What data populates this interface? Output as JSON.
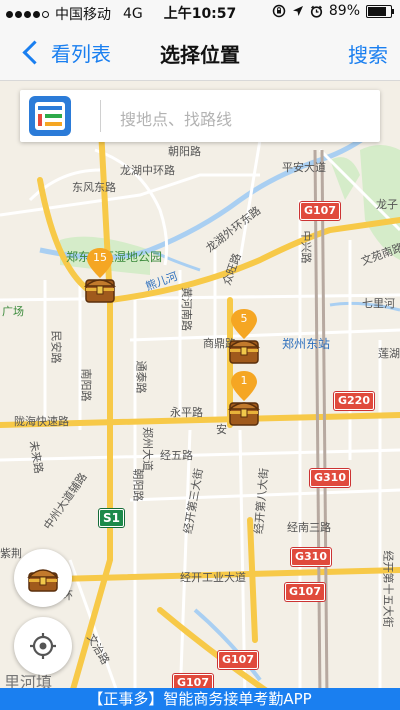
{
  "status_bar": {
    "carrier": "中国移动",
    "network": "4G",
    "time": "上午10:57",
    "battery": "89%",
    "battery_level": 0.89
  },
  "navbar": {
    "back_label": "看列表",
    "title": "选择位置",
    "search_label": "搜索"
  },
  "search": {
    "placeholder": "搜地点、找路线"
  },
  "map": {
    "labels": [
      {
        "text": "朝阳路"
      },
      {
        "text": "龙湖中环路"
      },
      {
        "text": "东风东路"
      },
      {
        "text": "龙湖外环东路"
      },
      {
        "text": "平安大道"
      },
      {
        "text": "龙子"
      },
      {
        "text": "文苑南路"
      },
      {
        "text": "中兴路"
      },
      {
        "text": "众旺路"
      },
      {
        "text": "熊儿河"
      },
      {
        "text": "郑东新区湿地公园"
      },
      {
        "text": "广场"
      },
      {
        "text": "黄河南路"
      },
      {
        "text": "商鼎路"
      },
      {
        "text": "郑州东站"
      },
      {
        "text": "七里河"
      },
      {
        "text": "莲湖"
      },
      {
        "text": "民安路"
      },
      {
        "text": "南阳路"
      },
      {
        "text": "通泰路"
      },
      {
        "text": "永平路"
      },
      {
        "text": "陇海快速路"
      },
      {
        "text": "未来路"
      },
      {
        "text": "郑州大道"
      },
      {
        "text": "经五路"
      },
      {
        "text": "朝阳路"
      },
      {
        "text": "经开第三大街"
      },
      {
        "text": "经开第八大街"
      },
      {
        "text": "经南三路"
      },
      {
        "text": "中州大道辅路"
      },
      {
        "text": "经开工业大道"
      },
      {
        "text": "紫荆"
      },
      {
        "text": "环"
      },
      {
        "text": "文治路"
      },
      {
        "text": "经开第十五大街"
      },
      {
        "text": "安"
      },
      {
        "text": "里河填"
      }
    ],
    "shields": [
      {
        "text": "G107",
        "color": "red"
      },
      {
        "text": "G220",
        "color": "red"
      },
      {
        "text": "G310",
        "color": "red"
      },
      {
        "text": "G310",
        "color": "red"
      },
      {
        "text": "G107",
        "color": "red"
      },
      {
        "text": "G107",
        "color": "red"
      },
      {
        "text": "G107",
        "color": "red"
      },
      {
        "text": "S1",
        "color": "green"
      }
    ],
    "markers": [
      {
        "count": "15"
      },
      {
        "count": "5"
      },
      {
        "count": "1"
      }
    ]
  },
  "banner": {
    "text": "【正事多】智能商务接单考勤APP"
  },
  "colors": {
    "accent": "#1a7ff0",
    "marker": "#f5a623",
    "road_major": "#f7c948",
    "shield_red": "#e04a3c",
    "shield_green": "#1d8a4a"
  }
}
